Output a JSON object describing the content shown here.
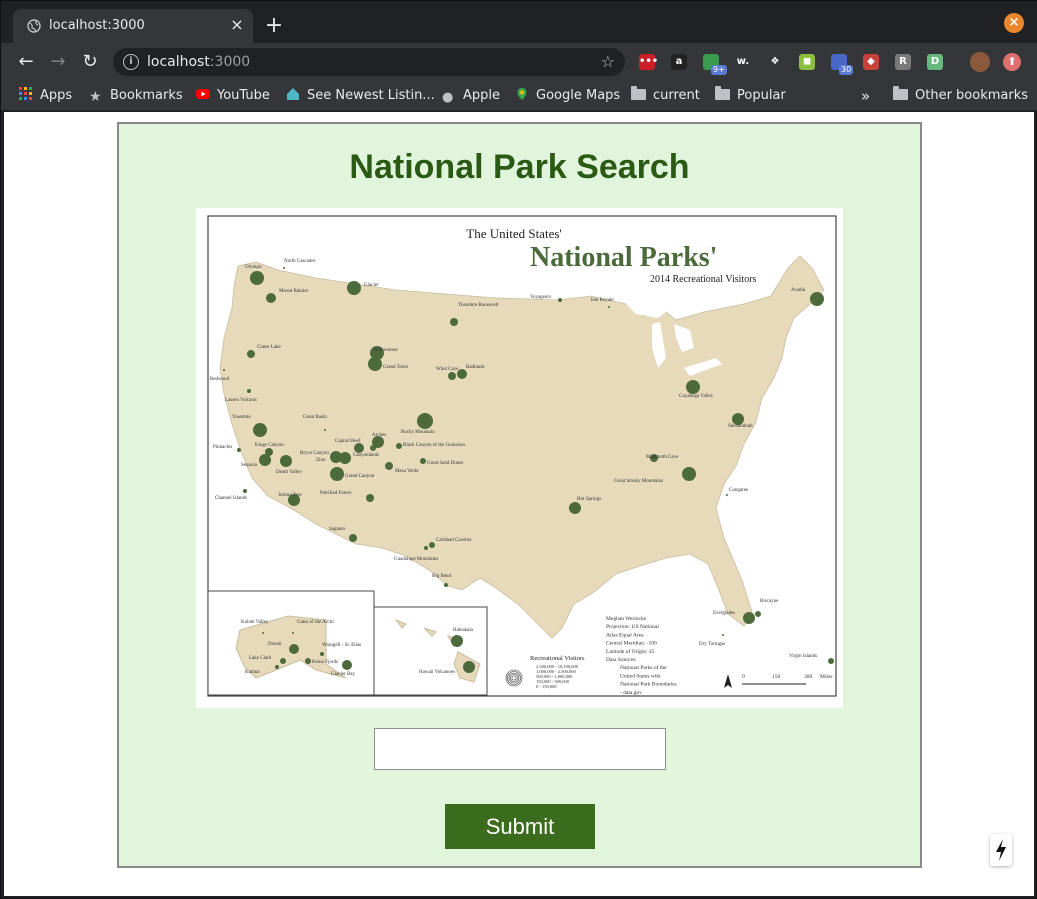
{
  "browser": {
    "tab_title": "localhost:3000",
    "url_host": "localhost",
    "url_port": ":3000",
    "new_tab_label": "+",
    "tab_close_label": "×",
    "window_close_label": "×",
    "extensions": [
      {
        "name": "lastpass-icon",
        "color": "#cc2029",
        "glyph": "•••"
      },
      {
        "name": "amazon-icon",
        "color": "#222222",
        "glyph": "a"
      },
      {
        "name": "chat-icon",
        "color": "#3a9b4f",
        "glyph": "",
        "badge": "9+"
      },
      {
        "name": "wordtune-icon",
        "color": "#35363a",
        "glyph": "w."
      },
      {
        "name": "dropbox-icon",
        "color": "#35363a",
        "glyph": "❖"
      },
      {
        "name": "extension-green-icon",
        "color": "#8cbf3f",
        "glyph": "◼"
      },
      {
        "name": "calendar-icon",
        "color": "#4a68c8",
        "glyph": "",
        "badge": "30"
      },
      {
        "name": "extension-red-icon",
        "color": "#c9413b",
        "glyph": "◆"
      },
      {
        "name": "extension-grey-icon",
        "color": "#7a7a7a",
        "glyph": "R"
      },
      {
        "name": "extension-d-icon",
        "color": "#67b87f",
        "glyph": "D"
      }
    ]
  },
  "bookmarks": {
    "apps": "Apps",
    "bookmarks": "Bookmarks",
    "youtube": "YouTube",
    "newest_listings": "See Newest Listin...",
    "apple": "Apple",
    "google_maps": "Google Maps",
    "current": "current",
    "popular": "Popular",
    "overflow": "»",
    "other": "Other bookmarks"
  },
  "page": {
    "title": "National Park Search",
    "search_value": "",
    "search_placeholder": "",
    "submit_label": "Submit"
  },
  "map": {
    "title_top": "The United States'",
    "title_main": "National Parks'",
    "subtitle": "2014 Recreational Visitors",
    "legend_title": "Recreational Visitors",
    "legend_items": [
      "2,500,000 - 10,100,000",
      "1,000,000 - 2,500,000",
      "500,000 - 1,000,000",
      "150,000 - 500,000",
      "0 - 150,000"
    ],
    "credit": [
      "Meghan Wernicke",
      "Projection: US National",
      "Atlas Equal Area",
      "Central Meridian: -100",
      "Latitude of Origin: 45",
      "Data Sources:",
      "National Parks of the",
      "United States wiki",
      "National Park Boundaries",
      "- data.gov"
    ],
    "scale_labels": [
      "0",
      "150",
      "300",
      "Miles"
    ],
    "north": "N",
    "parks": [
      "Olympic",
      "North Cascades",
      "Mount Rainier",
      "Glacier",
      "Theodore Roosevelt",
      "Voyageurs",
      "Isle Royale",
      "Acadia",
      "Crater Lake",
      "Redwood",
      "Lassen Volcanic",
      "Yellowstone",
      "Grand Teton",
      "Wind Cave",
      "Badlands",
      "Cuyahoga Valley",
      "Great Basin",
      "Yosemite",
      "Pinnacles",
      "Kings Canyon",
      "Sequoia",
      "Capitol Reef",
      "Arches",
      "Bryce Canyon",
      "Zion",
      "Canyonlands",
      "Black Canyon of the Gunnison",
      "Rocky Mountain",
      "Great Sand Dunes",
      "Shenandoah",
      "Death Valley",
      "Grand Canyon",
      "Mesa Verde",
      "Mammoth Cave",
      "Great Smoky Mountains",
      "Channel Islands",
      "Joshua Tree",
      "Petrified Forest",
      "Congaree",
      "Hot Springs",
      "Saguaro",
      "Carlsbad Caverns",
      "Guadalupe Mountains",
      "Big Bend",
      "Everglades",
      "Biscayne",
      "Dry Tortugas",
      "Kobuk Valley",
      "Gates of the Arctic",
      "Denali",
      "Wrangell - St. Elias",
      "Lake Clark",
      "Katmai",
      "Kenai Fjords",
      "Glacier Bay",
      "Haleakala",
      "Hawaii Volcanoes",
      "Virgin Islands"
    ]
  }
}
